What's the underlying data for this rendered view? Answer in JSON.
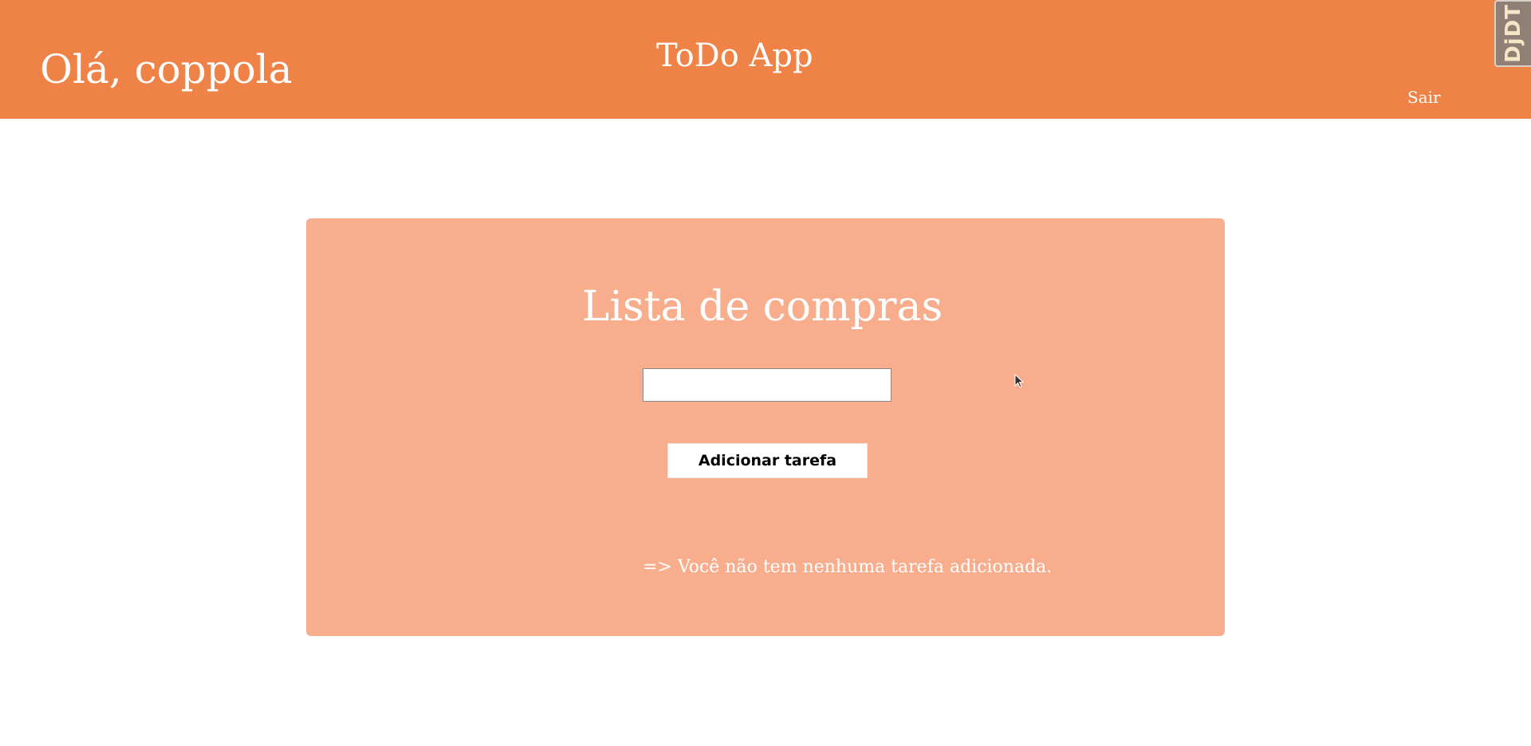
{
  "header": {
    "greeting": "Olá, coppola",
    "app_title": "ToDo App",
    "logout_label": "Sair",
    "debug_toolbar_label": "DjDT"
  },
  "list": {
    "title": "Lista de compras",
    "input_value": "",
    "add_button_label": "Adicionar tarefa",
    "empty_message": "=> Você não tem nenhuma tarefa adicionada."
  },
  "colors": {
    "header_bg": "#ef8347",
    "card_bg": "#f8ad8c",
    "text": "#ffffff"
  },
  "icons": {
    "cursor": "mouse-pointer-icon"
  }
}
